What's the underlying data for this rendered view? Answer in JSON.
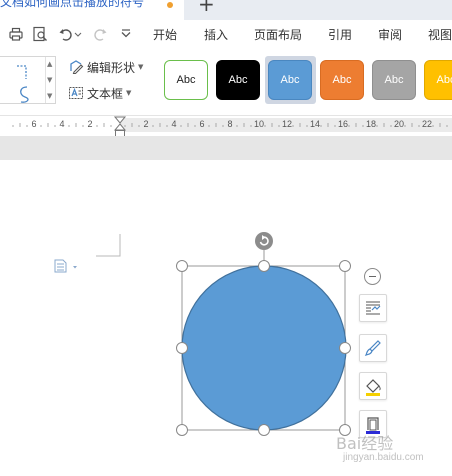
{
  "tabs": {
    "doc_title": "文档如何画点击播放的符号"
  },
  "menu": {
    "items": [
      "开始",
      "插入",
      "页面布局",
      "引用",
      "审阅",
      "视图"
    ]
  },
  "ribbon": {
    "edit_shape": "编辑形状",
    "text_box": "文本框",
    "style_swatches": [
      {
        "label": "Abc",
        "fill": "#ffffff",
        "border": "#6abf4b",
        "text": "#222222"
      },
      {
        "label": "Abc",
        "fill": "#000000",
        "border": "#000000",
        "text": "#ffffff"
      },
      {
        "label": "Abc",
        "fill": "#5b9bd5",
        "border": "#4a87c0",
        "text": "#ffffff"
      },
      {
        "label": "Abc",
        "fill": "#ed7d31",
        "border": "#d86c22",
        "text": "#ffffff"
      },
      {
        "label": "Abc",
        "fill": "#a5a5a5",
        "border": "#8f8f8f",
        "text": "#ffffff"
      },
      {
        "label": "Abc",
        "fill": "#ffc000",
        "border": "#e0a800",
        "text": "#ffffff"
      }
    ]
  },
  "ruler": {
    "labels": [
      "6",
      "4",
      "2",
      "2",
      "4",
      "6",
      "8",
      "10",
      "12",
      "14",
      "16",
      "18",
      "20",
      "22"
    ]
  },
  "shape": {
    "fill": "#5b9bd5",
    "outline": "#41719c",
    "handle_color": "#888888"
  },
  "watermark": {
    "text": "Bai经验",
    "url": "jingyan.baidu.com"
  }
}
